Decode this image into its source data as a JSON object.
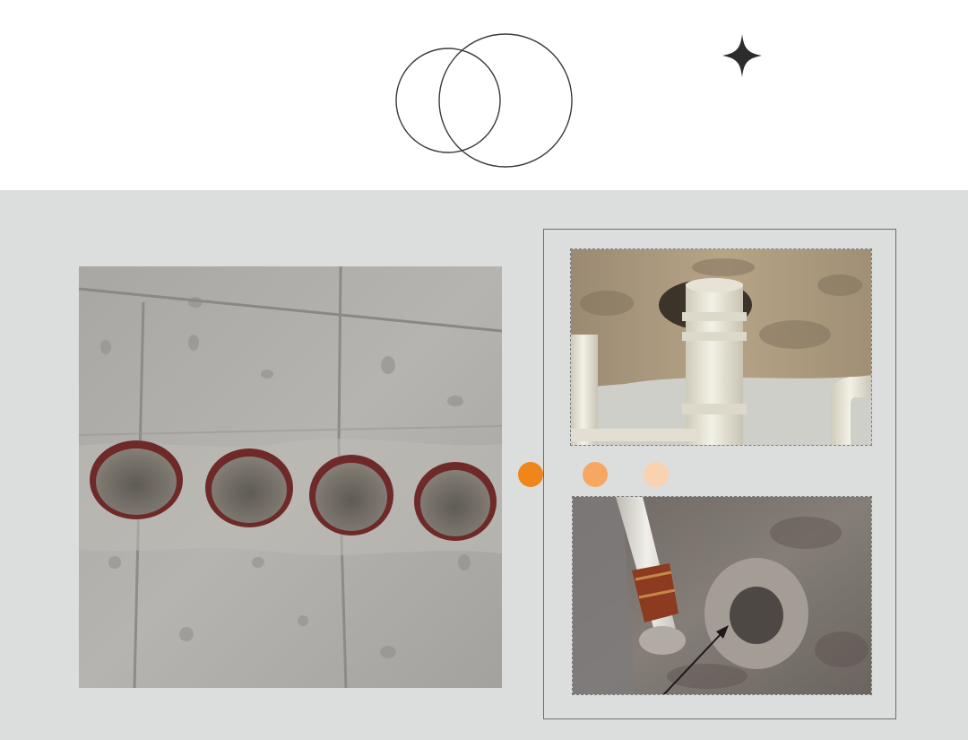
{
  "decor": {
    "circles_icon": "overlapping-circles-icon",
    "sparkle_icon": "four-point-star-icon",
    "line_color": "#3a3a3a"
  },
  "colors": {
    "top_background": "#ffffff",
    "bottom_background": "#dcdedd",
    "frame_border": "#6e6e6e",
    "dot_1": "#f0861b",
    "dot_2": "#f5a763",
    "dot_3": "#f9d3b1"
  },
  "photos": [
    {
      "name": "concrete-wall-pipe-holes-photo",
      "label": ""
    },
    {
      "name": "ceiling-pvc-pipe-photo",
      "label": ""
    },
    {
      "name": "floor-pipe-penetration-photo",
      "label": ""
    }
  ]
}
